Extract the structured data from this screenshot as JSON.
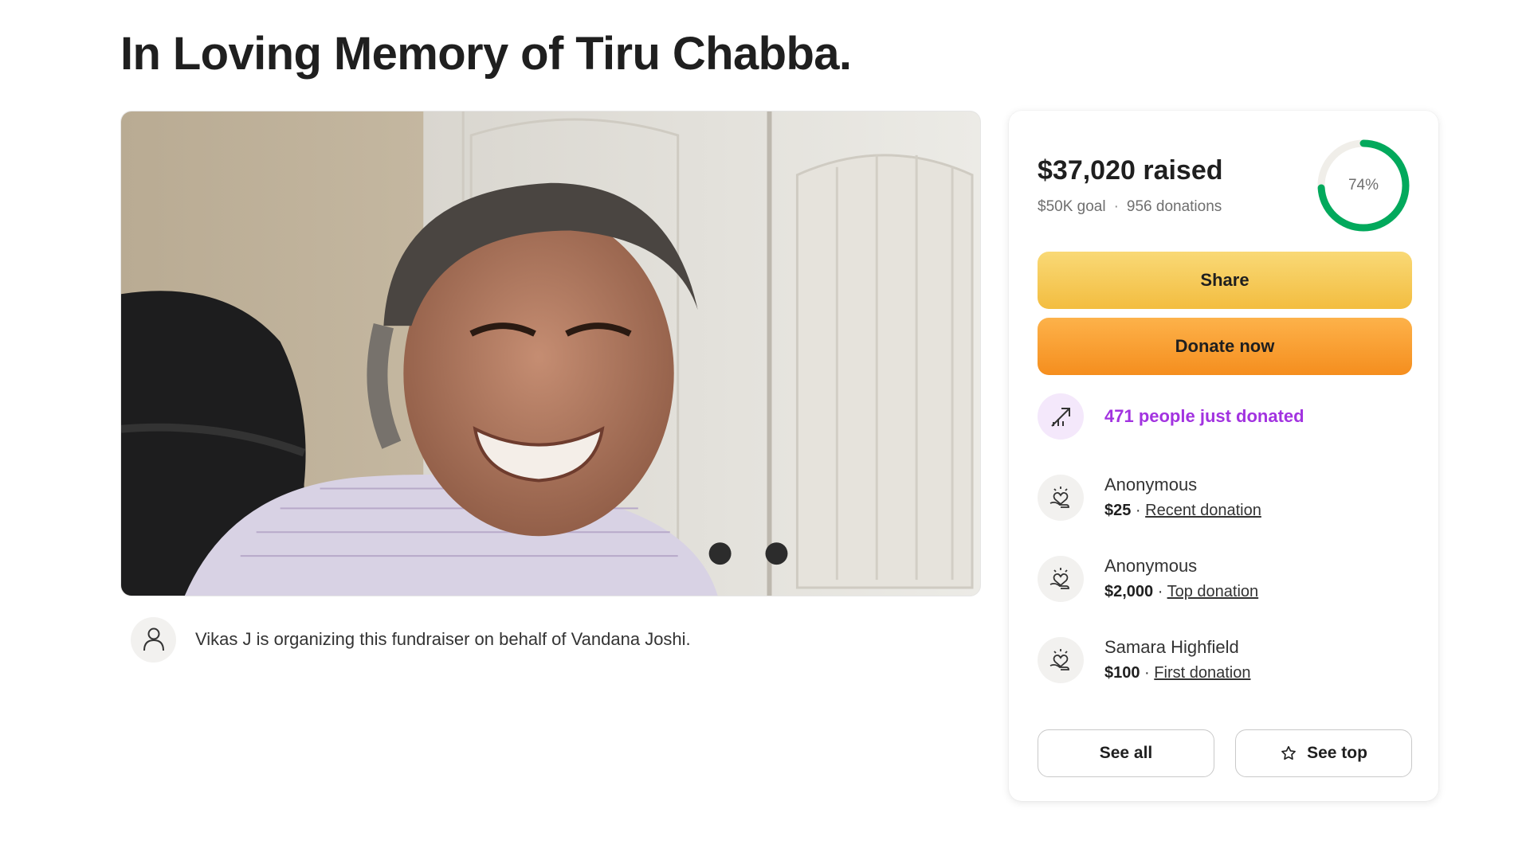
{
  "page": {
    "title": "In Loving Memory of Tiru Chabba."
  },
  "organizer": {
    "text": "Vikas J is organizing this fundraiser on behalf of Vandana Joshi.",
    "avatar_icon": "user-icon"
  },
  "campaign": {
    "raised": "$37,020 raised",
    "goal": "$50K goal",
    "separator": "·",
    "donations": "956 donations",
    "progress_percent": 74,
    "progress_label": "74%",
    "progress_color": "#02a95c"
  },
  "actions": {
    "share_label": "Share",
    "donate_label": "Donate now"
  },
  "trend": {
    "label": "471 people just donated",
    "icon": "trending-up-icon",
    "color": "#a233e0"
  },
  "donors": [
    {
      "name": "Anonymous",
      "amount": "$25",
      "sep": " · ",
      "tag": "Recent donation"
    },
    {
      "name": "Anonymous",
      "amount": "$2,000",
      "sep": " · ",
      "tag": "Top donation"
    },
    {
      "name": "Samara Highfield",
      "amount": "$100",
      "sep": " · ",
      "tag": "First donation"
    }
  ],
  "footer_buttons": {
    "see_all": "See all",
    "see_top": "See top",
    "see_top_icon": "star-icon"
  }
}
